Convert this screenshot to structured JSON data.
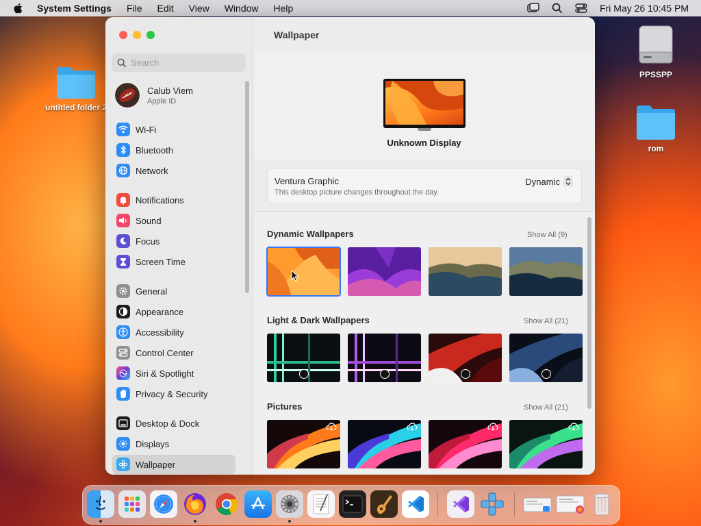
{
  "menubar": {
    "app_name": "System Settings",
    "menus": [
      "File",
      "Edit",
      "View",
      "Window",
      "Help"
    ],
    "clock": "Fri May 26  10:45 PM"
  },
  "desktop": {
    "icons": [
      {
        "label": "untitled folder 2"
      },
      {
        "label": "PPSSPP"
      },
      {
        "label": "rom"
      }
    ]
  },
  "sidebar": {
    "search_placeholder": "Search",
    "account": {
      "name": "Calub Viem",
      "subtitle": "Apple ID"
    },
    "items": [
      {
        "label": "Wi-Fi",
        "icon": "wifi-icon",
        "color": "#2e8cf5"
      },
      {
        "label": "Bluetooth",
        "icon": "bluetooth-icon",
        "color": "#2e8cf5"
      },
      {
        "label": "Network",
        "icon": "globe-icon",
        "color": "#2e8cf5"
      },
      {
        "label": "Notifications",
        "icon": "bell-icon",
        "color": "#f24b3e"
      },
      {
        "label": "Sound",
        "icon": "speaker-icon",
        "color": "#f2466a"
      },
      {
        "label": "Focus",
        "icon": "moon-icon",
        "color": "#5b4fd6"
      },
      {
        "label": "Screen Time",
        "icon": "hourglass-icon",
        "color": "#5b4fd6"
      },
      {
        "label": "General",
        "icon": "gear-icon",
        "color": "#8e8e93"
      },
      {
        "label": "Appearance",
        "icon": "appearance-icon",
        "color": "#1c1c1e"
      },
      {
        "label": "Accessibility",
        "icon": "accessibility-icon",
        "color": "#2e8cf5"
      },
      {
        "label": "Control Center",
        "icon": "control-center-icon",
        "color": "#8e8e93"
      },
      {
        "label": "Siri & Spotlight",
        "icon": "siri-icon",
        "color": "#6b3fd1"
      },
      {
        "label": "Privacy & Security",
        "icon": "hand-icon",
        "color": "#2e8cf5"
      },
      {
        "label": "Desktop & Dock",
        "icon": "dock-icon",
        "color": "#1c1c1e"
      },
      {
        "label": "Displays",
        "icon": "sun-icon",
        "color": "#2e8cf5"
      },
      {
        "label": "Wallpaper",
        "icon": "wallpaper-icon",
        "color": "#39a8f0"
      }
    ],
    "selected": "Wallpaper"
  },
  "content": {
    "title": "Wallpaper",
    "display_name": "Unknown Display",
    "current": {
      "name": "Ventura Graphic",
      "description": "This desktop picture changes throughout the day.",
      "mode": "Dynamic"
    },
    "sections": [
      {
        "title": "Dynamic Wallpapers",
        "show_all": "Show All (9)"
      },
      {
        "title": "Light & Dark Wallpapers",
        "show_all": "Show All (21)"
      },
      {
        "title": "Pictures",
        "show_all": "Show All (21)"
      }
    ]
  },
  "dock": {
    "apps": [
      "finder-icon",
      "launchpad-icon",
      "safari-icon",
      "firefox-icon",
      "chrome-icon",
      "app-store-icon",
      "system-settings-icon",
      "textedit-icon",
      "terminal-icon",
      "garageband-icon",
      "vscode-icon",
      "visual-studio-icon",
      "ppsspp-icon",
      "screenshot-icon",
      "photo-icon",
      "trash-icon"
    ]
  },
  "colors": {
    "accent": "#3478f6",
    "close": "#fe5f57",
    "minimize": "#febc2e",
    "zoom": "#28c840"
  }
}
